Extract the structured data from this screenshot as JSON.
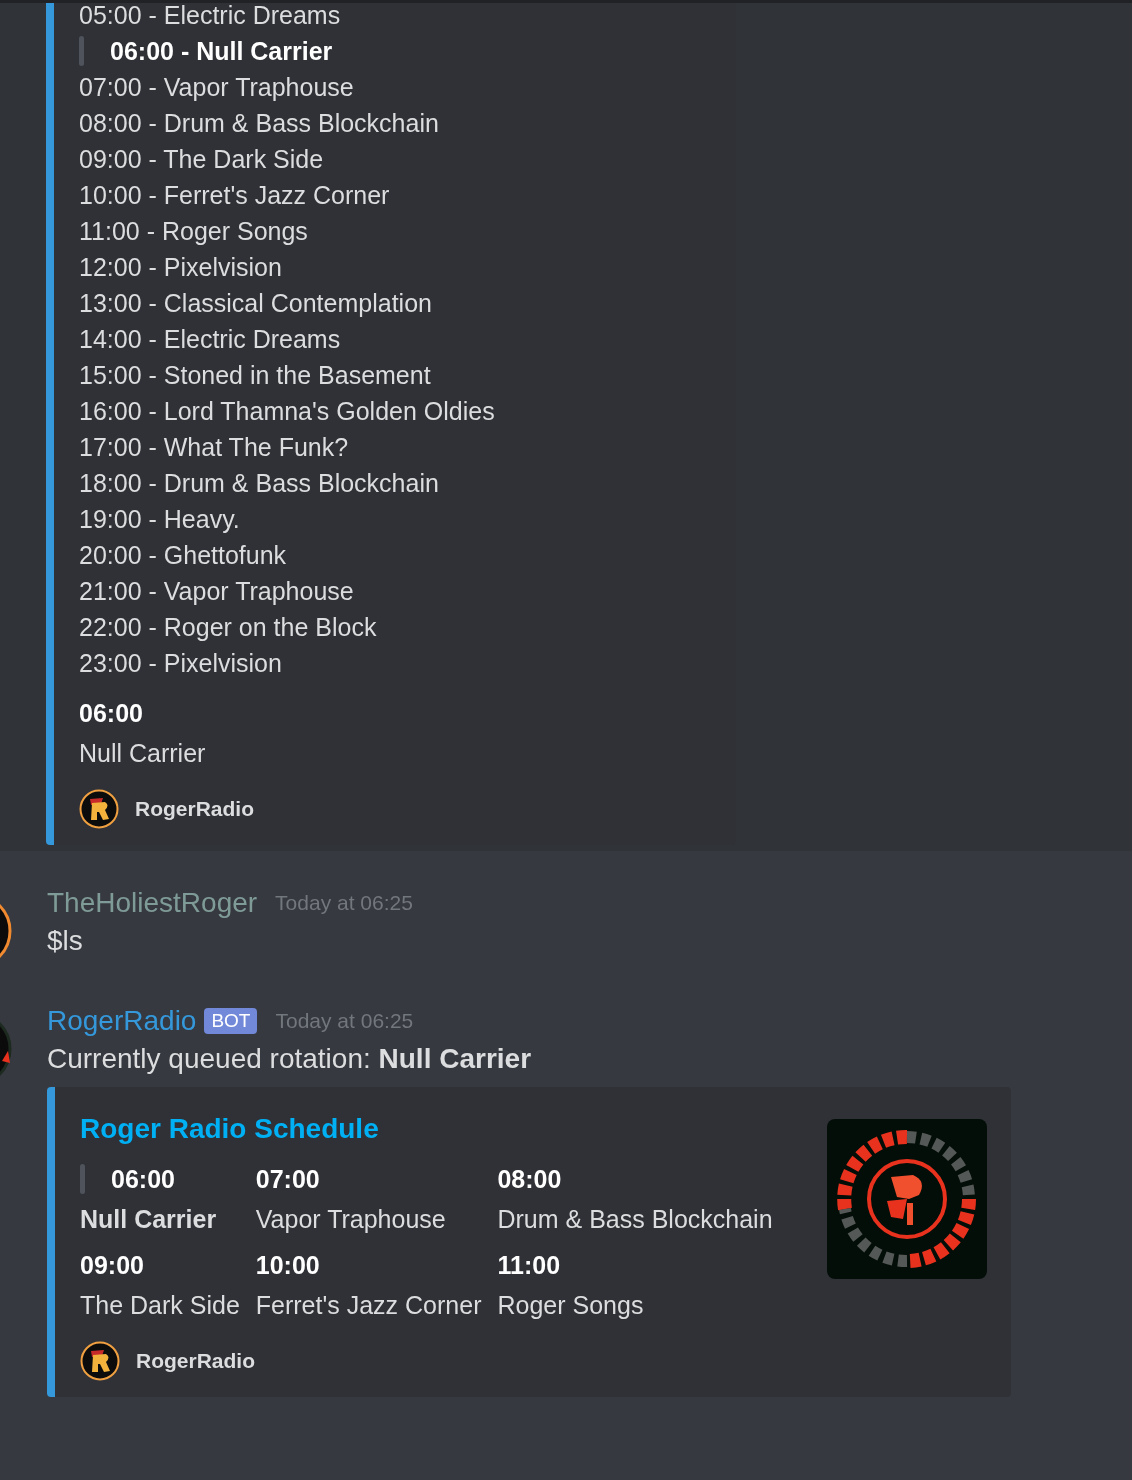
{
  "top_embed": {
    "schedule": [
      {
        "text": "05:00 - Electric Dreams",
        "current": false
      },
      {
        "text": "06:00 - Null Carrier",
        "current": true
      },
      {
        "text": "07:00 - Vapor Traphouse",
        "current": false
      },
      {
        "text": "08:00 - Drum & Bass Blockchain",
        "current": false
      },
      {
        "text": "09:00 - The Dark Side",
        "current": false
      },
      {
        "text": "10:00 - Ferret's Jazz Corner",
        "current": false
      },
      {
        "text": "11:00 - Roger Songs",
        "current": false
      },
      {
        "text": "12:00 - Pixelvision",
        "current": false
      },
      {
        "text": "13:00 - Classical Contemplation",
        "current": false
      },
      {
        "text": "14:00 - Electric Dreams",
        "current": false
      },
      {
        "text": "15:00 - Stoned in the Basement",
        "current": false
      },
      {
        "text": "16:00 - Lord Thamna's Golden Oldies",
        "current": false
      },
      {
        "text": "17:00 - What The Funk?",
        "current": false
      },
      {
        "text": "18:00 - Drum & Bass Blockchain",
        "current": false
      },
      {
        "text": "19:00 - Heavy.",
        "current": false
      },
      {
        "text": "20:00 - Ghettofunk",
        "current": false
      },
      {
        "text": "21:00 - Vapor Traphouse",
        "current": false
      },
      {
        "text": "22:00 - Roger on the Block",
        "current": false
      },
      {
        "text": "23:00 - Pixelvision",
        "current": false
      }
    ],
    "field": {
      "name": "06:00",
      "value": "Null Carrier"
    },
    "footer": "RogerRadio"
  },
  "messages": [
    {
      "author": "TheHoliestRoger",
      "color": "#7f9b98",
      "timestamp": "Today at 06:25",
      "content": "$ls"
    },
    {
      "author": "RogerRadio",
      "color": "#3498db",
      "badge": "BOT",
      "timestamp": "Today at 06:25",
      "content": "Currently queued rotation: **Null Carrier**",
      "embed": {
        "title": "Roger Radio Schedule",
        "fields": [
          {
            "name": "06:00",
            "value": "Null Carrier",
            "current": true
          },
          {
            "name": "07:00",
            "value": "Vapor Traphouse",
            "current": false
          },
          {
            "name": "08:00",
            "value": "Drum & Bass Blockchain",
            "current": false
          },
          {
            "name": "09:00",
            "value": "The Dark Side",
            "current": false
          },
          {
            "name": "10:00",
            "value": "Ferret's Jazz Corner",
            "current": false
          },
          {
            "name": "11:00",
            "value": "Roger Songs",
            "current": false
          }
        ],
        "footer": "RogerRadio"
      }
    }
  ]
}
